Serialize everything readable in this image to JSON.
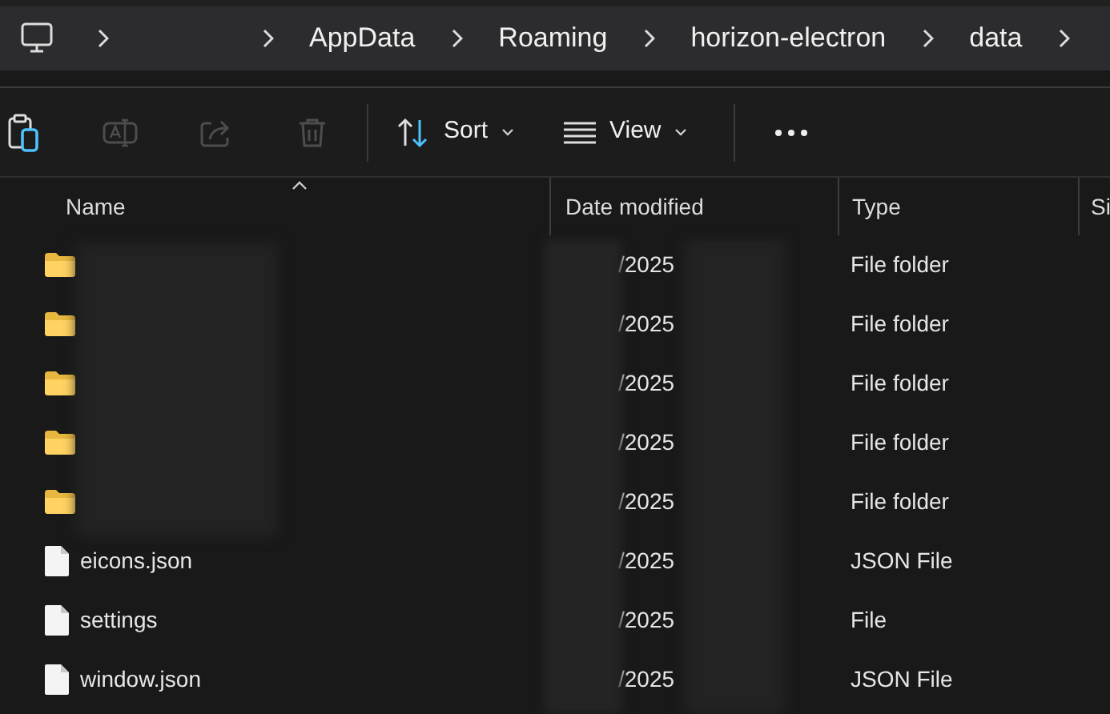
{
  "breadcrumb": {
    "segments": [
      "AppData",
      "Roaming",
      "horizon-electron",
      "data"
    ]
  },
  "toolbar": [
    {
      "kind": "paste",
      "disabled": false
    },
    {
      "kind": "rename",
      "disabled": true
    },
    {
      "kind": "share",
      "disabled": true
    },
    {
      "kind": "delete",
      "disabled": true
    },
    {
      "kind": "separator"
    },
    {
      "kind": "sort",
      "label": "Sort"
    },
    {
      "kind": "view",
      "label": "View"
    },
    {
      "kind": "separator"
    },
    {
      "kind": "more"
    }
  ],
  "columns": [
    {
      "label": "Name",
      "sorted": true
    },
    {
      "label": "Date modified",
      "sorted": false
    },
    {
      "label": "Type",
      "sorted": false
    },
    {
      "label": "Si",
      "sorted": false
    }
  ],
  "rows": [
    {
      "kind": "folder",
      "date": "/2025",
      "type": "File folder"
    },
    {
      "kind": "folder",
      "date": "/2025",
      "type": "File folder"
    },
    {
      "kind": "folder",
      "date": "/2025",
      "type": "File folder"
    },
    {
      "kind": "folder",
      "date": "/2025",
      "type": "File folder"
    },
    {
      "kind": "folder",
      "date": "/2025",
      "type": "File folder"
    },
    {
      "kind": "file",
      "name": "eicons.json",
      "date": "/2025",
      "type": "JSON File"
    },
    {
      "kind": "file",
      "name": "settings",
      "date": "/2025",
      "type": "File"
    },
    {
      "kind": "file",
      "name": "window.json",
      "date": "/2025",
      "type": "JSON File"
    }
  ]
}
